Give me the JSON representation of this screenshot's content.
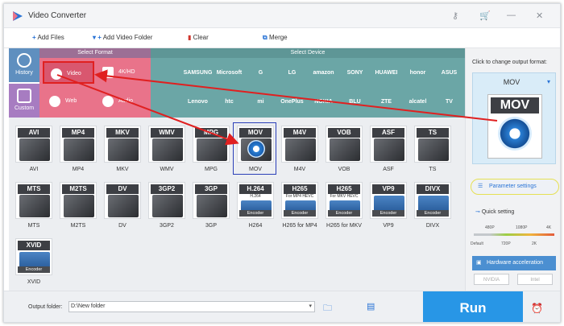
{
  "window": {
    "title": "Video Converter"
  },
  "titlebar_icons": [
    "key-icon",
    "cart-icon",
    "minimize-icon",
    "close-icon"
  ],
  "toolbar": {
    "add_files": "Add Files",
    "add_video_folder": "Add Video Folder",
    "clear": "Clear",
    "merge": "Merge"
  },
  "left_categories": [
    {
      "label": "History",
      "icon": "clock-icon",
      "color": "#5f8fbf"
    },
    {
      "label": "Custom",
      "icon": "palette-icon",
      "color": "#a77cc1"
    }
  ],
  "select_format": {
    "header": "Select Format",
    "buttons": [
      {
        "label": "Video",
        "icon": "play-icon"
      },
      {
        "label": "4K/HD",
        "icon": "hd-icon"
      },
      {
        "label": "Web",
        "icon": "chrome-icon"
      },
      {
        "label": "Audio",
        "icon": "audio-icon"
      }
    ]
  },
  "select_device": {
    "header": "Select Device",
    "brands": [
      "",
      "SAMSUNG",
      "Microsoft",
      "G",
      "LG",
      "amazon",
      "SONY",
      "HUAWEI",
      "honor",
      "ASUS",
      "",
      "Lenovo",
      "htc",
      "mi",
      "OnePlus",
      "NOKIA",
      "BLU",
      "ZTE",
      "alcatel",
      "TV"
    ]
  },
  "formats": [
    {
      "tag": "AVI",
      "label": "AVI"
    },
    {
      "tag": "MP4",
      "label": "MP4"
    },
    {
      "tag": "MKV",
      "label": "MKV"
    },
    {
      "tag": "WMV",
      "label": "WMV"
    },
    {
      "tag": "MPG",
      "label": "MPG"
    },
    {
      "tag": "MOV",
      "label": "MOV"
    },
    {
      "tag": "M4V",
      "label": "M4V"
    },
    {
      "tag": "VOB",
      "label": "VOB"
    },
    {
      "tag": "ASF",
      "label": "ASF"
    },
    {
      "tag": "TS",
      "label": "TS"
    },
    {
      "tag": "MTS",
      "label": "MTS"
    },
    {
      "tag": "M2TS",
      "label": "M2TS"
    },
    {
      "tag": "DV",
      "label": "DV"
    },
    {
      "tag": "3GP2",
      "label": "3GP2"
    },
    {
      "tag": "3GP",
      "label": "3GP"
    },
    {
      "tag": "H.264",
      "label": "H264",
      "sub": "H.264",
      "encoder": "Encoder"
    },
    {
      "tag": "H265",
      "label": "H265 for MP4",
      "sub": "For MP4 HEVC",
      "encoder": "Encoder"
    },
    {
      "tag": "H265",
      "label": "H265 for MKV",
      "sub": "For MKV HEVC",
      "encoder": "Encoder"
    },
    {
      "tag": "VP9",
      "label": "VP9",
      "encoder": "Encoder"
    },
    {
      "tag": "DIVX",
      "label": "DIVX",
      "encoder": "Encoder"
    },
    {
      "tag": "XVID",
      "label": "XVID",
      "encoder": "Encoder"
    }
  ],
  "selected_format": "MOV",
  "right_panel": {
    "hint": "Click to change output format:",
    "output_format": "MOV",
    "parameter_settings": "Parameter settings",
    "quick_setting": "Quick setting",
    "quality_ticks_top": [
      "480P",
      "1080P",
      "4K"
    ],
    "quality_ticks_bottom": [
      "Default",
      "720P",
      "2K"
    ],
    "hardware_acceleration": "Hardware acceleration",
    "gpu_chips": [
      "NVIDIA",
      "Intel"
    ]
  },
  "bottom": {
    "output_folder_label": "Output folder:",
    "output_folder_value": "D:\\New folder",
    "run": "Run"
  },
  "colors": {
    "format_panel": "#e9738a",
    "device_panel": "#6ba6a6",
    "run_button": "#2896e6",
    "annotation_red": "#e02020",
    "annotation_yellow": "#e6e053"
  }
}
